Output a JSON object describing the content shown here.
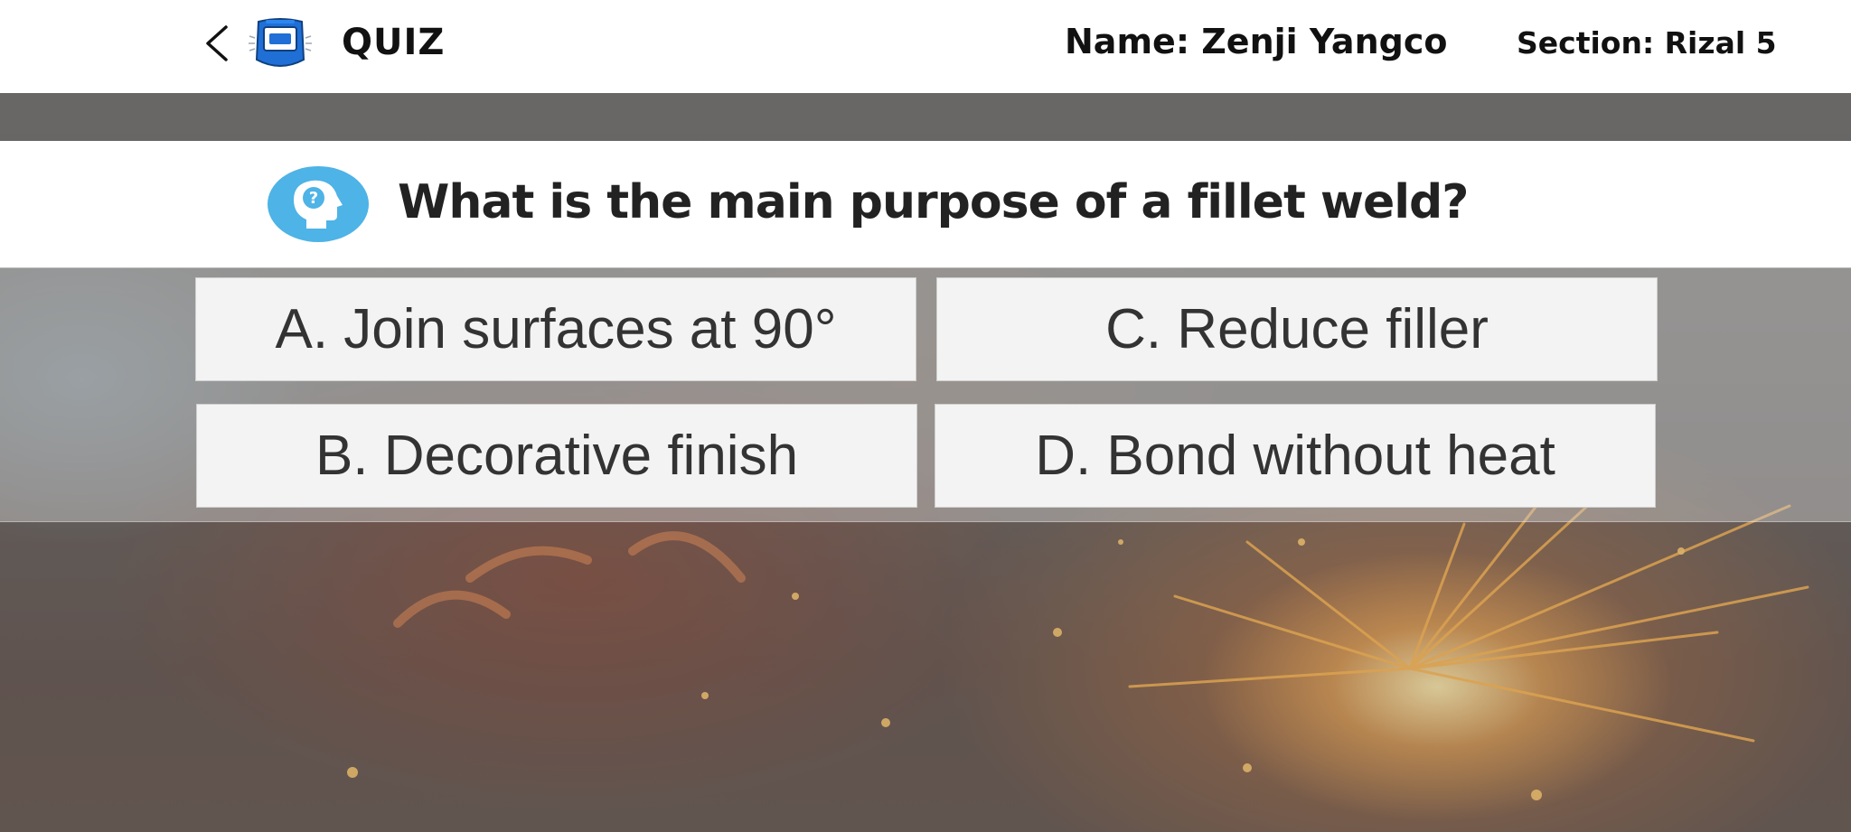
{
  "header": {
    "title": "QUIZ",
    "student_name": "Name: Zenji Yangco",
    "student_section": "Section: Rizal 5"
  },
  "icons": {
    "back": "chevron-left-icon",
    "app_logo": "welding-helmet-icon",
    "question": "head-question-icon"
  },
  "colors": {
    "question_icon": "#4eb3e6",
    "app_logo_blue": "#1f6fd6",
    "answer_background": "#f3f3f3"
  },
  "question": {
    "text": "What is the main purpose of a fillet weld?"
  },
  "answers": [
    {
      "label": "A. Join surfaces at 90°"
    },
    {
      "label": "B. Decorative finish"
    },
    {
      "label": "C. Reduce filler"
    },
    {
      "label": "D. Bond without heat"
    }
  ]
}
